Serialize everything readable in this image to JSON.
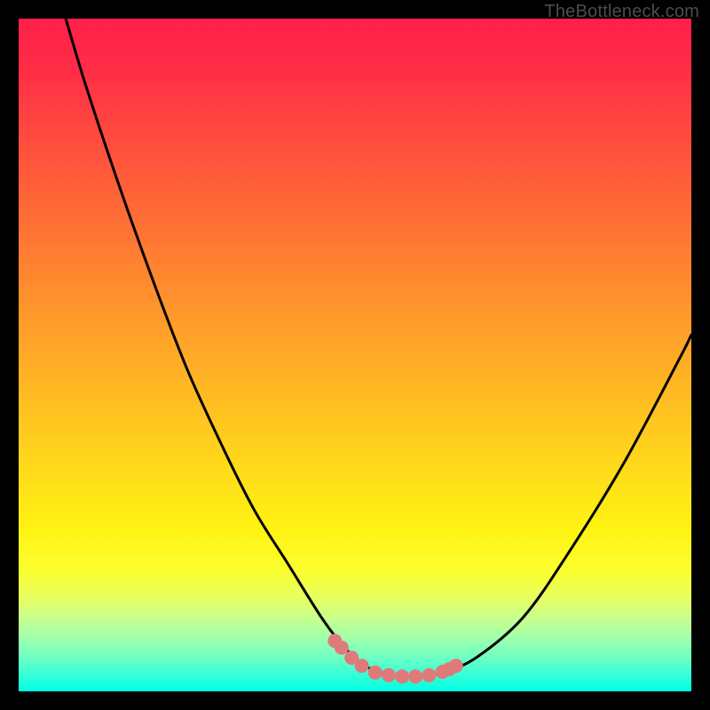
{
  "watermark": "TheBottleneck.com",
  "colors": {
    "frame": "#000000",
    "watermark": "#4c4c4c",
    "curve": "#000000",
    "markers": "#e07a7a",
    "gradient_stops": [
      "#ff1f4a",
      "#ff2e46",
      "#ff4c3e",
      "#ff6f35",
      "#ff922c",
      "#ffb524",
      "#ffd81b",
      "#fff312",
      "#fbff2e",
      "#e8ff60",
      "#c9ff8b",
      "#a1ffab",
      "#6effc3",
      "#2bffdc",
      "#00ffe0"
    ]
  },
  "chart_data": {
    "type": "line",
    "title": "",
    "xlabel": "",
    "ylabel": "",
    "xlim": [
      0,
      100
    ],
    "ylim": [
      0,
      100
    ],
    "grid": false,
    "legend": false,
    "series": [
      {
        "name": "bottleneck-curve",
        "x": [
          7,
          10,
          15,
          20,
          25,
          30,
          35,
          40,
          45,
          48,
          50,
          52,
          55,
          58,
          60,
          63,
          68,
          75,
          82,
          90,
          98,
          100
        ],
        "y": [
          100,
          90,
          75,
          61,
          48,
          37,
          27,
          19,
          11,
          7,
          5,
          3.5,
          2.5,
          2.2,
          2.2,
          2.8,
          5,
          11,
          21,
          34,
          49,
          53
        ]
      }
    ],
    "markers": {
      "name": "highlight-dots",
      "x": [
        47,
        48,
        49.5,
        51,
        53,
        55,
        57,
        59,
        61,
        63,
        64,
        65
      ],
      "y": [
        7.5,
        6.5,
        5,
        3.8,
        2.8,
        2.4,
        2.2,
        2.2,
        2.4,
        2.9,
        3.3,
        3.8
      ]
    },
    "note": "x and y are percentages of the 758x758 plot area (0,0 bottom-left). Values read visually from the figure."
  }
}
